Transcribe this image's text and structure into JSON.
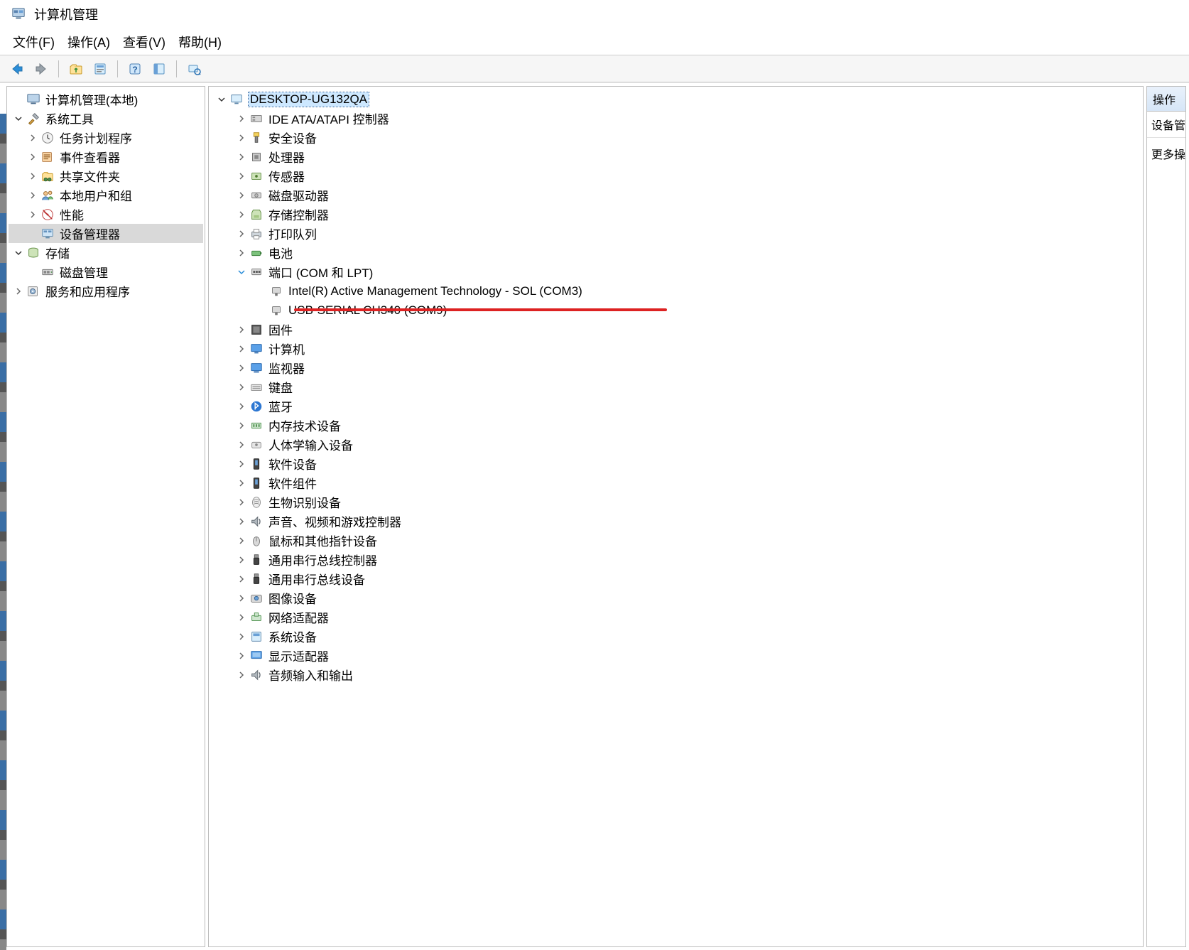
{
  "window": {
    "title": "计算机管理"
  },
  "menu": {
    "file": "文件(F)",
    "action": "操作(A)",
    "view": "查看(V)",
    "help": "帮助(H)"
  },
  "right_panel": {
    "header": "操作",
    "section": "设备管理器",
    "more": "更多操作"
  },
  "left_tree": {
    "root": "计算机管理(本地)",
    "system_tools": "系统工具",
    "task_scheduler": "任务计划程序",
    "event_viewer": "事件查看器",
    "shared_folders": "共享文件夹",
    "local_users": "本地用户和组",
    "performance": "性能",
    "device_manager": "设备管理器",
    "storage": "存储",
    "disk_mgmt": "磁盘管理",
    "services_apps": "服务和应用程序"
  },
  "device_tree": {
    "root": "DESKTOP-UG132QA",
    "ide": "IDE ATA/ATAPI 控制器",
    "security_devices": "安全设备",
    "processors": "处理器",
    "sensors": "传感器",
    "disk_drives": "磁盘驱动器",
    "storage_controllers": "存储控制器",
    "print_queues": "打印队列",
    "batteries": "电池",
    "ports": "端口 (COM 和 LPT)",
    "port_sol": "Intel(R) Active Management Technology - SOL (COM3)",
    "port_ch340": "USB-SERIAL CH340 (COM9)",
    "firmware": "固件",
    "computers": "计算机",
    "monitors": "监视器",
    "keyboards": "键盘",
    "bluetooth": "蓝牙",
    "memory_tech": "内存技术设备",
    "hid": "人体学输入设备",
    "software_devices": "软件设备",
    "software_components": "软件组件",
    "biometric": "生物识别设备",
    "sound": "声音、视频和游戏控制器",
    "mice": "鼠标和其他指针设备",
    "usb_controllers": "通用串行总线控制器",
    "usb_devices": "通用串行总线设备",
    "imaging": "图像设备",
    "network": "网络适配器",
    "system_devices": "系统设备",
    "display": "显示适配器",
    "audio_io": "音频输入和输出"
  }
}
